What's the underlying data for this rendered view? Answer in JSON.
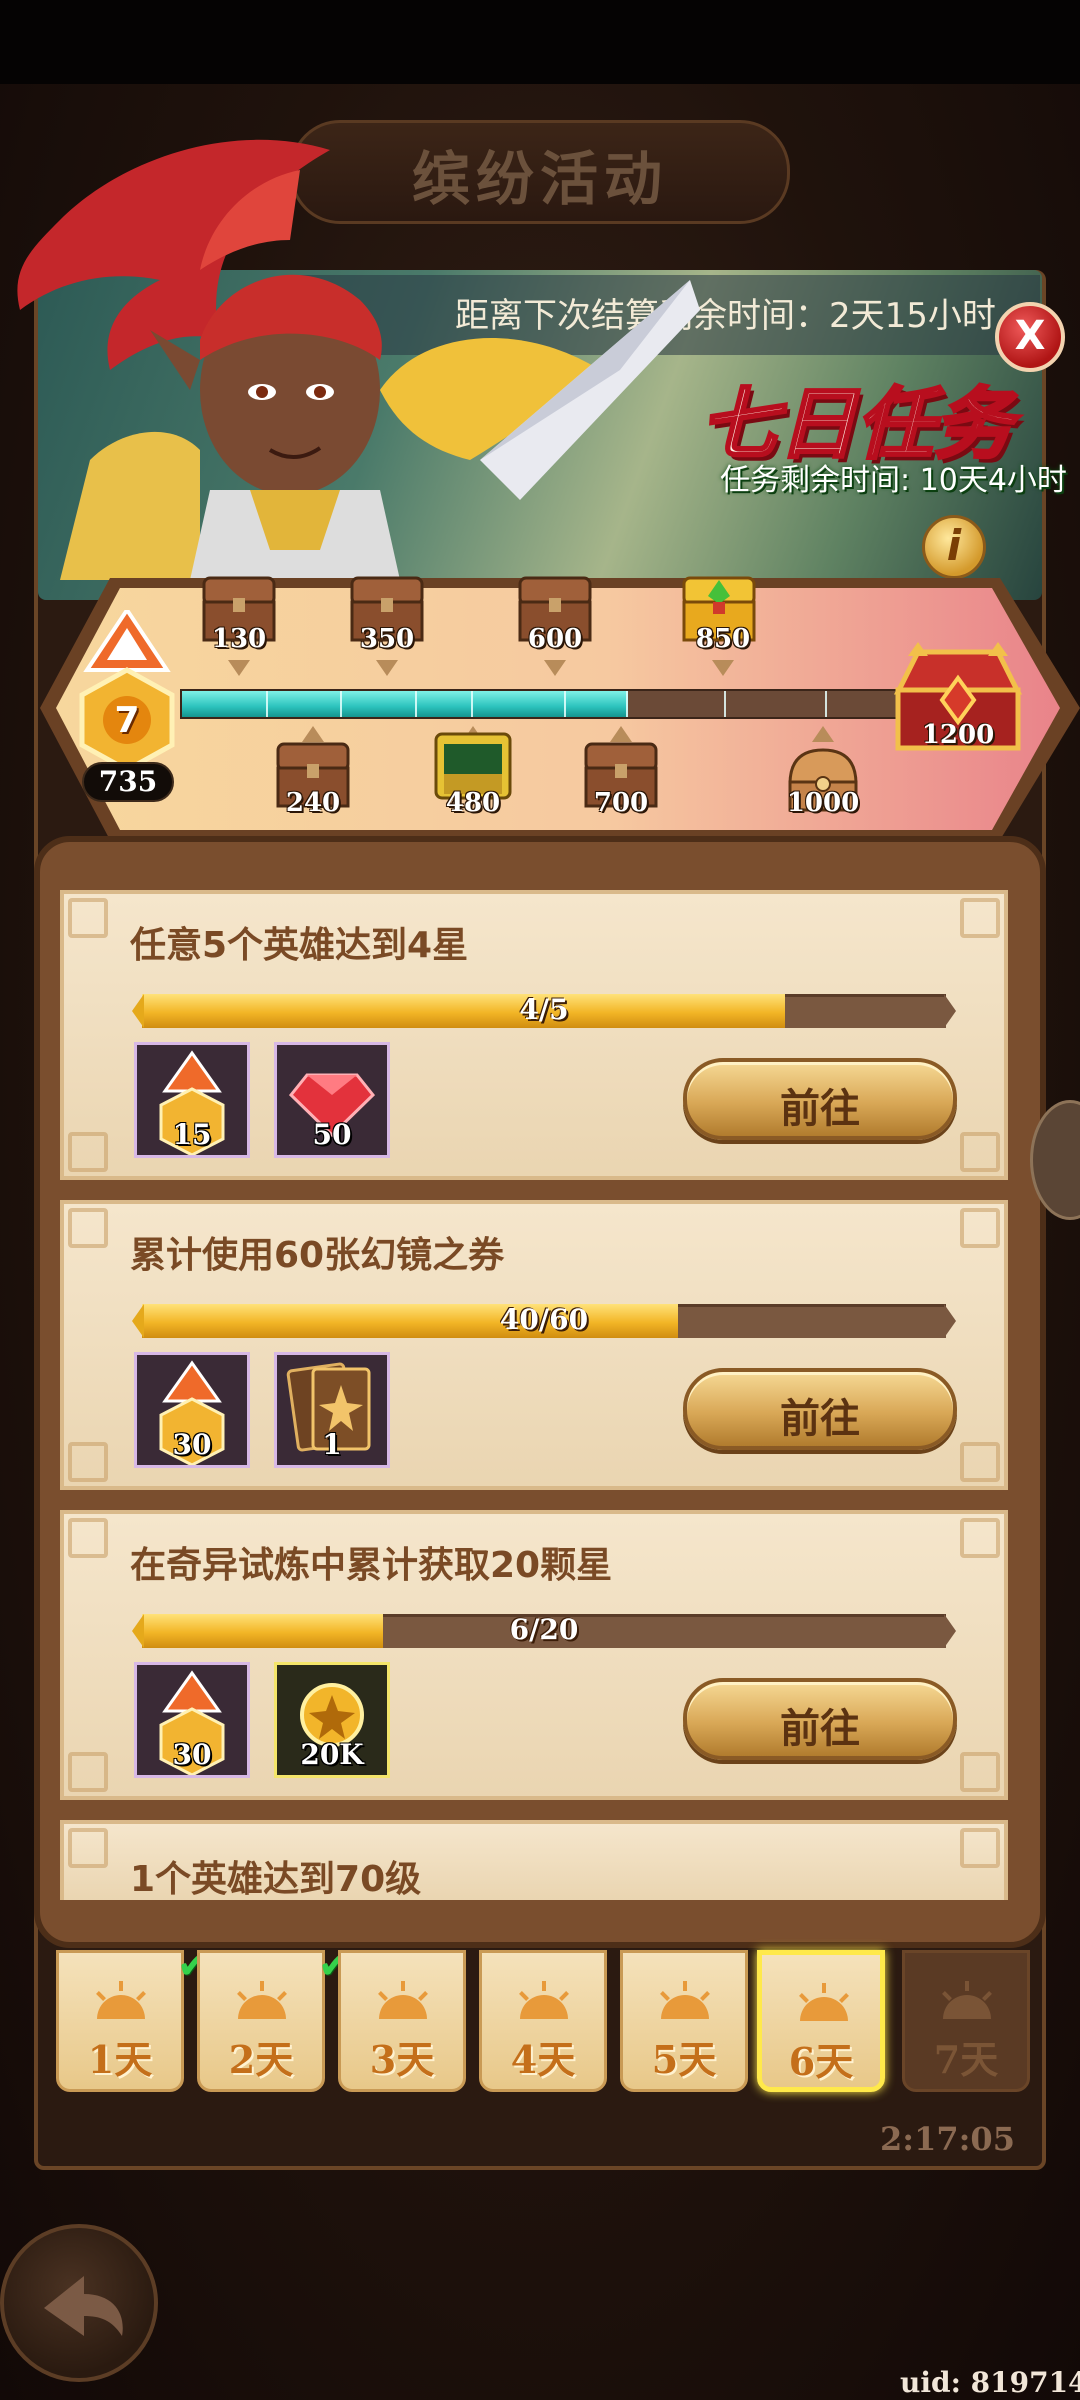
{
  "event": {
    "title": "缤纷活动"
  },
  "settlement": {
    "text": "距离下次结算剩余时间：2天15小时"
  },
  "seven_day": {
    "title": "七日任务",
    "remaining": "任务剩余时间: 10天4小时"
  },
  "close_label": "X",
  "info_label": "i",
  "points": {
    "level": "7",
    "value": "735",
    "max": 1200,
    "fill_fraction": 0.615
  },
  "milestones_top": [
    "130",
    "350",
    "600",
    "850"
  ],
  "milestones_bottom": [
    "240",
    "480",
    "700",
    "1000"
  ],
  "milestone_final": "1200",
  "tasks": [
    {
      "title": "任意5个英雄达到4星",
      "progress_text": "4/5",
      "progress": 0.8,
      "rewards": [
        {
          "icon": "hero-badge-icon",
          "qty": "15"
        },
        {
          "icon": "ruby-icon",
          "qty": "50"
        }
      ],
      "button": "前往"
    },
    {
      "title": "累计使用60张幻镜之券",
      "progress_text": "40/60",
      "progress": 0.667,
      "rewards": [
        {
          "icon": "hero-badge-icon",
          "qty": "30"
        },
        {
          "icon": "mirror-ticket-icon",
          "qty": "1"
        }
      ],
      "button": "前往"
    },
    {
      "title": "在奇异试炼中累计获取20颗星",
      "progress_text": "6/20",
      "progress": 0.3,
      "rewards": [
        {
          "icon": "hero-badge-icon",
          "qty": "30"
        },
        {
          "icon": "gold-coin-icon",
          "qty": "20K"
        }
      ],
      "button": "前往"
    },
    {
      "title": "1个英雄达到70级"
    }
  ],
  "days": [
    {
      "label": "1天",
      "completed": true
    },
    {
      "label": "2天",
      "completed": true
    },
    {
      "label": "3天",
      "completed": false
    },
    {
      "label": "4天",
      "completed": false
    },
    {
      "label": "5天",
      "completed": false
    },
    {
      "label": "6天",
      "completed": false,
      "active": true
    },
    {
      "label": "7天",
      "completed": false,
      "locked": true
    }
  ],
  "timer": "2:17:05",
  "uid": "uid: 819714",
  "colors": {
    "accent_gold": "#f2b526",
    "track_teal": "#2cc3bd",
    "close_red": "#c21a1a"
  }
}
